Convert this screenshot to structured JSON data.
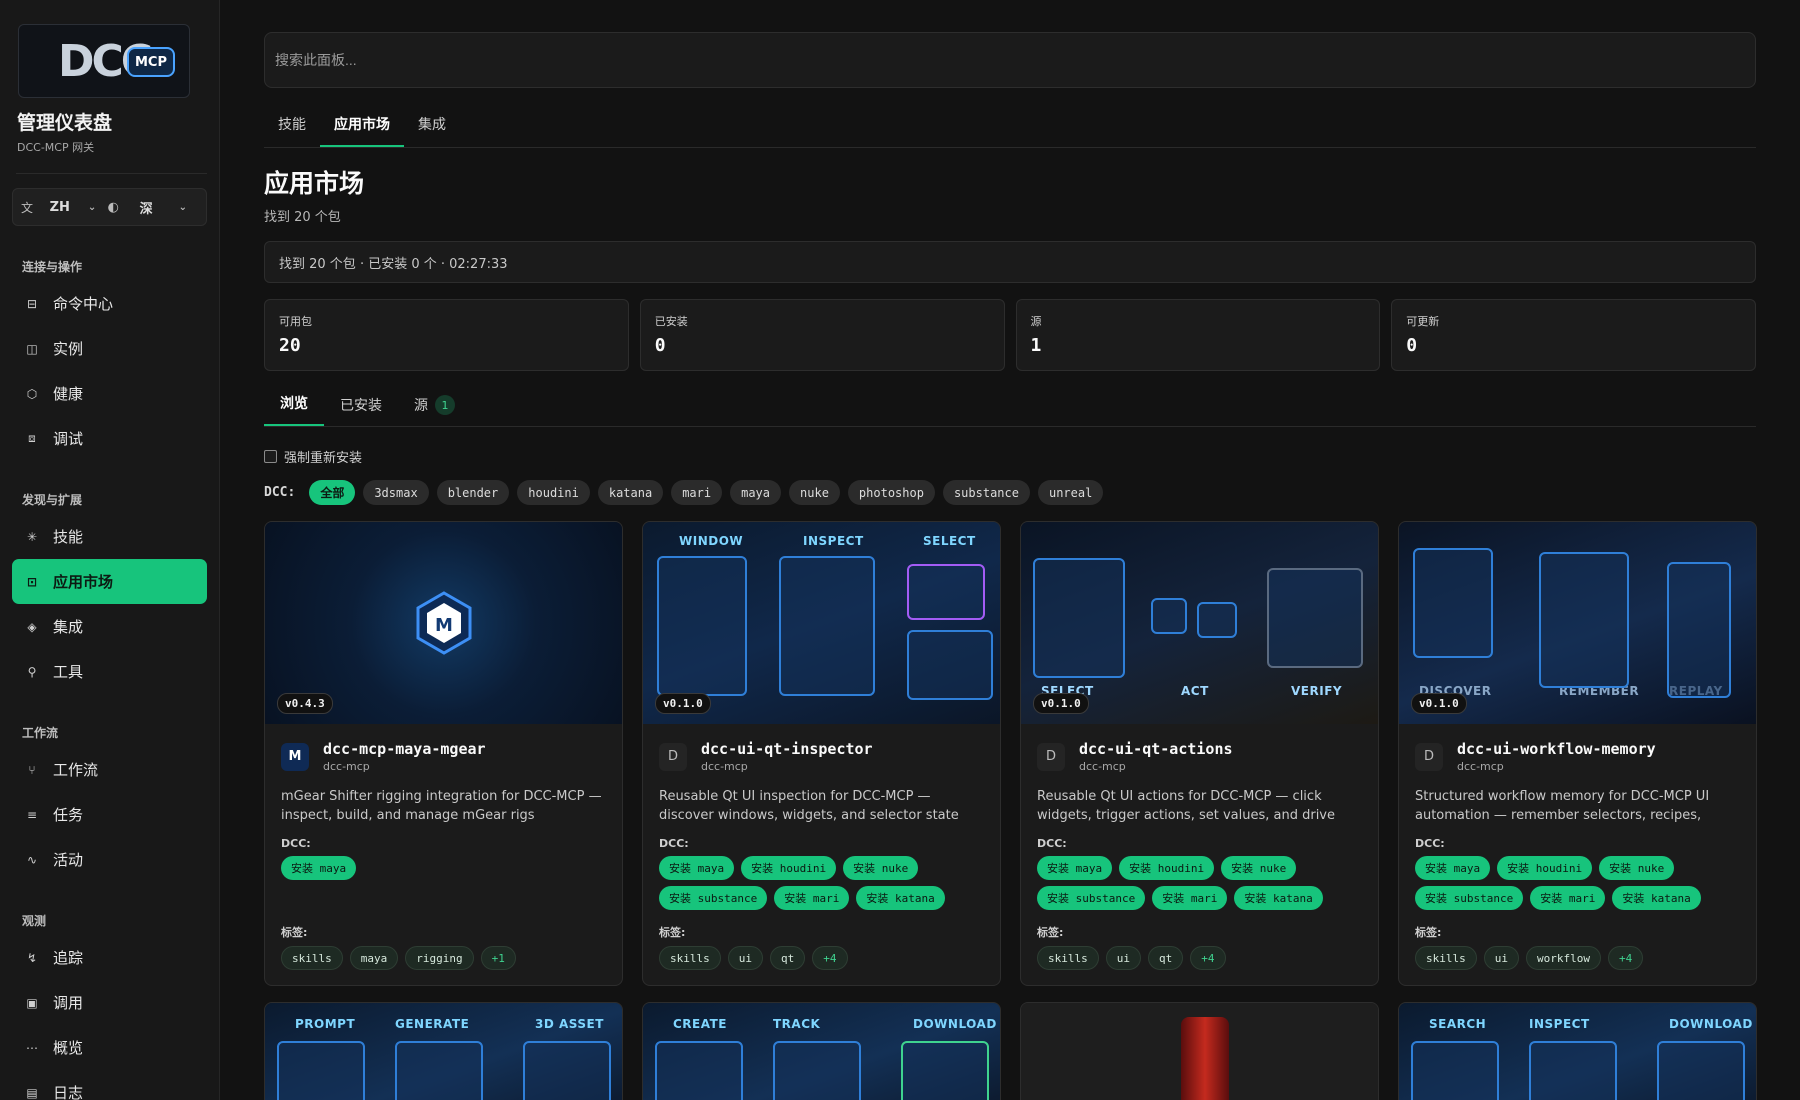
{
  "sidebar": {
    "logo_text": "DCC",
    "logo_badge": "MCP",
    "title": "管理仪表盘",
    "subtitle": "DCC-MCP 网关",
    "language": "ZH",
    "theme": "深",
    "groups": [
      {
        "label": "连接与操作",
        "items": [
          {
            "label": "命令中心",
            "icon": "terminal-icon"
          },
          {
            "label": "实例",
            "icon": "cpu-icon"
          },
          {
            "label": "健康",
            "icon": "shield-icon"
          },
          {
            "label": "调试",
            "icon": "bug-icon"
          }
        ]
      },
      {
        "label": "发现与扩展",
        "items": [
          {
            "label": "技能",
            "icon": "sparkle-icon"
          },
          {
            "label": "应用市场",
            "icon": "store-icon",
            "active": true
          },
          {
            "label": "集成",
            "icon": "layers-icon"
          },
          {
            "label": "工具",
            "icon": "wrench-icon"
          }
        ]
      },
      {
        "label": "工作流",
        "items": [
          {
            "label": "工作流",
            "icon": "workflow-icon"
          },
          {
            "label": "任务",
            "icon": "list-icon"
          },
          {
            "label": "活动",
            "icon": "activity-icon"
          }
        ]
      },
      {
        "label": "观测",
        "items": [
          {
            "label": "追踪",
            "icon": "trace-icon"
          },
          {
            "label": "调用",
            "icon": "call-icon"
          },
          {
            "label": "概览",
            "icon": "overview-icon"
          },
          {
            "label": "日志",
            "icon": "log-icon"
          }
        ]
      }
    ]
  },
  "search": {
    "placeholder": "搜索此面板..."
  },
  "tabs": [
    "技能",
    "应用市场",
    "集成"
  ],
  "page": {
    "title": "应用市场",
    "subtitle": "找到 20 个包",
    "status": "找到 20 个包 · 已安装 0 个 · 02:27:33"
  },
  "stats": [
    {
      "label": "可用包",
      "value": "20"
    },
    {
      "label": "已安装",
      "value": "0"
    },
    {
      "label": "源",
      "value": "1"
    },
    {
      "label": "可更新",
      "value": "0"
    }
  ],
  "subtabs": {
    "browse": "浏览",
    "installed": "已安装",
    "sources": "源",
    "sources_count": "1"
  },
  "force_reinstall": "强制重新安装",
  "dcc_filter": {
    "label": "DCC:",
    "options": [
      "全部",
      "3dsmax",
      "blender",
      "houdini",
      "katana",
      "mari",
      "maya",
      "nuke",
      "photoshop",
      "substance",
      "unreal"
    ]
  },
  "labels": {
    "dcc": "DCC:",
    "tags": "标签:"
  },
  "cards": [
    {
      "version": "v0.4.3",
      "name": "dcc-mcp-maya-mgear",
      "source": "dcc-mcp",
      "icon_letter": "M",
      "description": "mGear Shifter rigging integration for DCC-MCP — inspect, build, and manage mGear rigs",
      "dcc": [
        "安装 maya"
      ],
      "tags": [
        "skills",
        "maya",
        "rigging",
        "+1"
      ]
    },
    {
      "version": "v0.1.0",
      "name": "dcc-ui-qt-inspector",
      "source": "dcc-mcp",
      "icon_letter": "D",
      "description": "Reusable Qt UI inspection for DCC-MCP — discover windows, widgets, and selector state across...",
      "dcc": [
        "安装 maya",
        "安装 houdini",
        "安装 nuke",
        "安装 substance",
        "安装 mari",
        "安装 katana"
      ],
      "tags": [
        "skills",
        "ui",
        "qt",
        "+4"
      ],
      "thumb_labels": [
        "WINDOW",
        "INSPECT",
        "SELECT"
      ]
    },
    {
      "version": "v0.1.0",
      "name": "dcc-ui-qt-actions",
      "source": "dcc-mcp",
      "icon_letter": "D",
      "description": "Reusable Qt UI actions for DCC-MCP — click widgets, trigger actions, set values, and drive lega...",
      "dcc": [
        "安装 maya",
        "安装 houdini",
        "安装 nuke",
        "安装 substance",
        "安装 mari",
        "安装 katana"
      ],
      "tags": [
        "skills",
        "ui",
        "qt",
        "+4"
      ],
      "thumb_labels": [
        "SELECT",
        "ACT",
        "VERIFY"
      ]
    },
    {
      "version": "v0.1.0",
      "name": "dcc-ui-workflow-memory",
      "source": "dcc-mcp",
      "icon_letter": "D",
      "description": "Structured workflow memory for DCC-MCP UI automation — remember selectors, recipes, and...",
      "dcc": [
        "安装 maya",
        "安装 houdini",
        "安装 nuke",
        "安装 substance",
        "安装 mari",
        "安装 katana"
      ],
      "tags": [
        "skills",
        "ui",
        "workflow",
        "+4"
      ],
      "thumb_labels": [
        "DISCOVER",
        "REMEMBER",
        "REPLAY"
      ]
    }
  ],
  "cards_row2": [
    {
      "thumb_labels": [
        "PROMPT",
        "GENERATE",
        "3D ASSET"
      ]
    },
    {
      "thumb_labels": [
        "CREATE",
        "TRACK",
        "DOWNLOAD"
      ]
    },
    {
      "thumb_labels": []
    },
    {
      "thumb_labels": [
        "SEARCH",
        "INSPECT",
        "DOWNLOAD"
      ]
    }
  ],
  "colors": {
    "accent": "#17c47c",
    "background": "#121212",
    "panel": "#1b1b1b"
  }
}
